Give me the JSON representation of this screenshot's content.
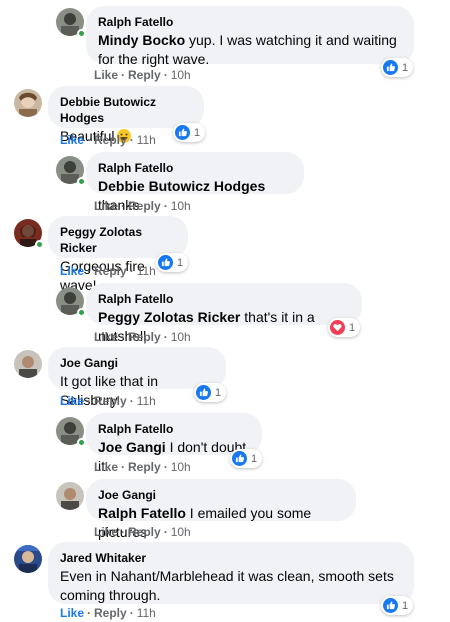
{
  "comments": [
    {
      "author": "Ralph Fatello",
      "mention": "Mindy Bocko",
      "text": " yup. I was watching it and waiting for the right wave.",
      "like": "Like",
      "reply": "Reply",
      "time": "10h",
      "reactions": "1"
    },
    {
      "author": "Debbie Butowicz Hodges",
      "text": "Beautiful",
      "like": "Like",
      "reply": "Reply",
      "time": "11h",
      "reactions": "1"
    },
    {
      "author": "Ralph Fatello",
      "mention": "Debbie Butowicz Hodges",
      "text": " thanks",
      "like": "Like",
      "reply": "Reply",
      "time": "10h"
    },
    {
      "author": "Peggy Zolotas Ricker",
      "text": "Gorgeous fire wave!",
      "like": "Like",
      "reply": "Reply",
      "time": "11h",
      "reactions": "1"
    },
    {
      "author": "Ralph Fatello",
      "mention": "Peggy Zolotas Ricker",
      "text": " that's it in a nutshell.",
      "like": "Like",
      "reply": "Reply",
      "time": "10h",
      "reactions": "1"
    },
    {
      "author": "Joe Gangi",
      "text": "It got like that in Salisbury",
      "like": "Like",
      "reply": "Reply",
      "time": "11h",
      "reactions": "1"
    },
    {
      "author": "Ralph Fatello",
      "mention": "Joe Gangi",
      "text": " I don't doubt it.",
      "like": "Like",
      "reply": "Reply",
      "time": "10h",
      "reactions": "1"
    },
    {
      "author": "Joe Gangi",
      "mention": "Ralph Fatello",
      "text": " I emailed you some pictures",
      "like": "Like",
      "reply": "Reply",
      "time": "10h"
    },
    {
      "author": "Jared Whitaker",
      "text": "Even in Nahant/Marblehead it was clean, smooth sets coming through.",
      "like": "Like",
      "reply": "Reply",
      "time": "11h",
      "reactions": "1"
    }
  ],
  "separator": "·",
  "colors": {
    "like": "#1877f2",
    "love": "#f33e58",
    "online": "#31a24c",
    "bubble": "#f0f2f5",
    "meta": "#65676b"
  },
  "icons": {
    "like": "thumbs-up-icon",
    "love": "heart-icon",
    "emoji": "grinning-emoji-icon"
  }
}
